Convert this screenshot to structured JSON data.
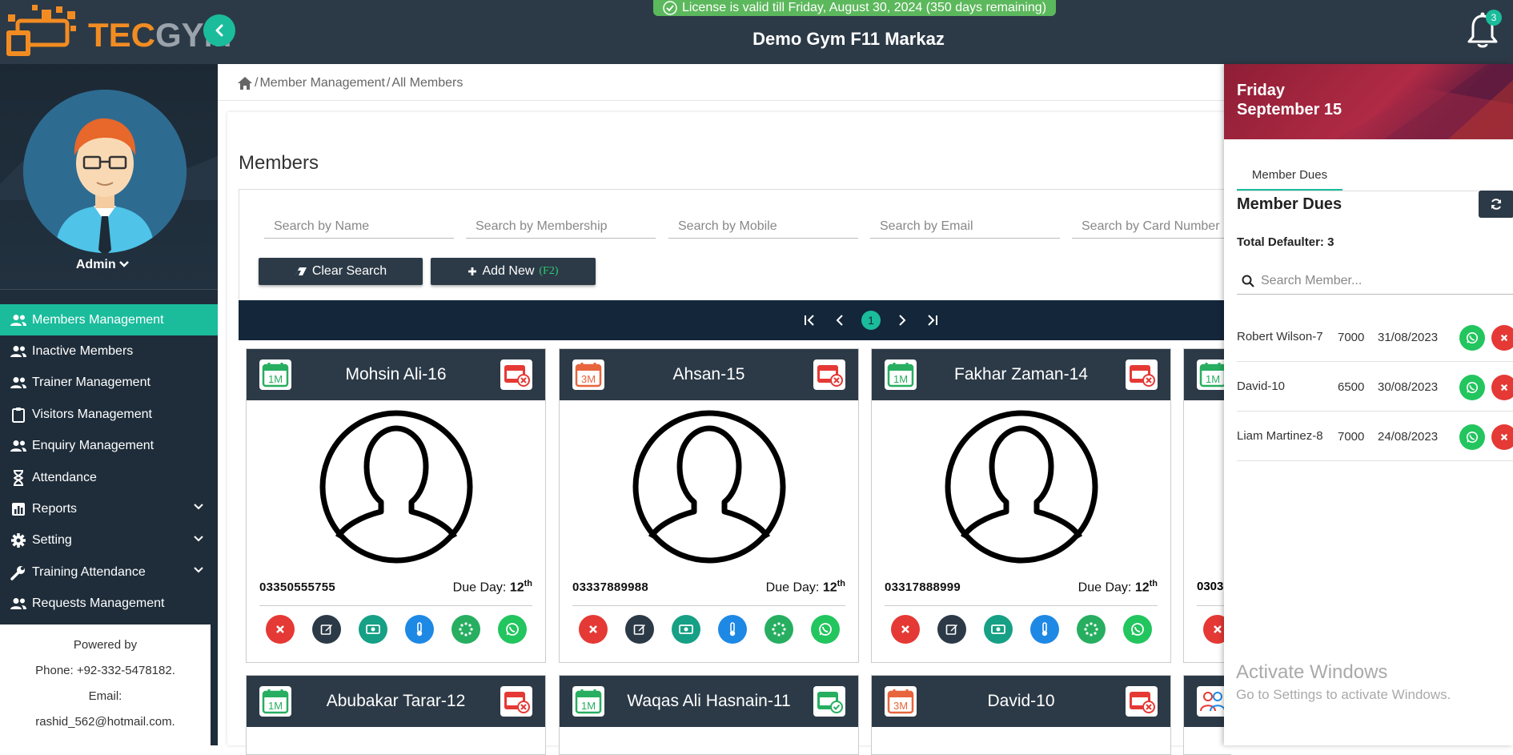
{
  "brand": {
    "logo_tec": "TEC",
    "logo_gym": "GYM"
  },
  "license": {
    "text": "License is valid till Friday, August 30, 2024 (350 days remaining)"
  },
  "header": {
    "gym_name": "Demo Gym F11 Markaz",
    "notification_count": "3"
  },
  "profile": {
    "name": "Admin"
  },
  "sidebar": {
    "items": [
      {
        "label": "Members Management",
        "icon": "users-icon",
        "active": true
      },
      {
        "label": "Inactive Members",
        "icon": "users-icon"
      },
      {
        "label": "Trainer Management",
        "icon": "users-icon"
      },
      {
        "label": "Visitors Management",
        "icon": "clipboard-icon"
      },
      {
        "label": "Enquiry Management",
        "icon": "users-icon"
      },
      {
        "label": "Attendance",
        "icon": "hourglass-icon"
      },
      {
        "label": "Reports",
        "icon": "bar-chart-icon",
        "expandable": true
      },
      {
        "label": "Setting",
        "icon": "gear-icon",
        "expandable": true
      },
      {
        "label": "Training Attendance",
        "icon": "wrench-icon",
        "expandable": true
      },
      {
        "label": "Requests Management",
        "icon": "users-icon"
      }
    ]
  },
  "powered": {
    "line1": "Powered by",
    "line2": "Phone: +92-332-5478182.",
    "line3": "Email:",
    "line4": "rashid_562@hotmail.com."
  },
  "breadcrumb": {
    "sep1": "/",
    "item1": "Member Management",
    "sep2": "/",
    "item2": "All Members"
  },
  "main": {
    "title": "Members",
    "search": {
      "name": "Search by Name",
      "membership": "Search by Membership",
      "mobile": "Search by Mobile",
      "email": "Search by Email",
      "card": "Search by Card Number"
    },
    "clear_label": "Clear Search",
    "add_label": "Add New",
    "add_shortcut": "(F2)",
    "current_page": "1"
  },
  "members": [
    {
      "name": "Mohsin Ali-16",
      "plan": "1M",
      "plan_color": "#27ae60",
      "phone": "03350555755",
      "due_label": "Due Day:",
      "due_day": "12",
      "due_suffix": "th"
    },
    {
      "name": "Ahsan-15",
      "plan": "3M",
      "plan_color": "#e8643c",
      "phone": "03337889988",
      "due_label": "Due Day:",
      "due_day": "12",
      "due_suffix": "th"
    },
    {
      "name": "Fakhar Zaman-14",
      "plan": "1M",
      "plan_color": "#27ae60",
      "phone": "03317888999",
      "due_label": "Due Day:",
      "due_day": "12",
      "due_suffix": "th"
    },
    {
      "name": "",
      "plan": "1M",
      "plan_color": "#27ae60",
      "phone": "0303",
      "due_label": "",
      "due_day": "",
      "due_suffix": ""
    },
    {
      "name": "Abubakar Tarar-12",
      "plan": "1M",
      "plan_color": "#27ae60"
    },
    {
      "name": "Waqas Ali Hasnain-11",
      "plan": "1M",
      "plan_color": "#27ae60"
    },
    {
      "name": "David-10",
      "plan": "3M",
      "plan_color": "#e8643c"
    }
  ],
  "right_panel": {
    "day": "Friday",
    "date": "September 15",
    "tab": "Member Dues",
    "title": "Member Dues",
    "total": "Total Defaulter: 3",
    "search_placeholder": "Search Member...",
    "dues": [
      {
        "name": "Robert Wilson-7",
        "amount": "7000",
        "date": "31/08/2023"
      },
      {
        "name": "David-10",
        "amount": "6500",
        "date": "30/08/2023"
      },
      {
        "name": "Liam Martinez-8",
        "amount": "7000",
        "date": "24/08/2023"
      }
    ]
  },
  "watermark": {
    "line1": "Activate Windows",
    "line2": "Go to Settings to activate Windows."
  },
  "colors": {
    "accent": "#1abc9c",
    "dark": "#2c3a47",
    "sidebar": "#1f2d3a",
    "danger": "#e53935",
    "whatsapp": "#22c55e"
  }
}
